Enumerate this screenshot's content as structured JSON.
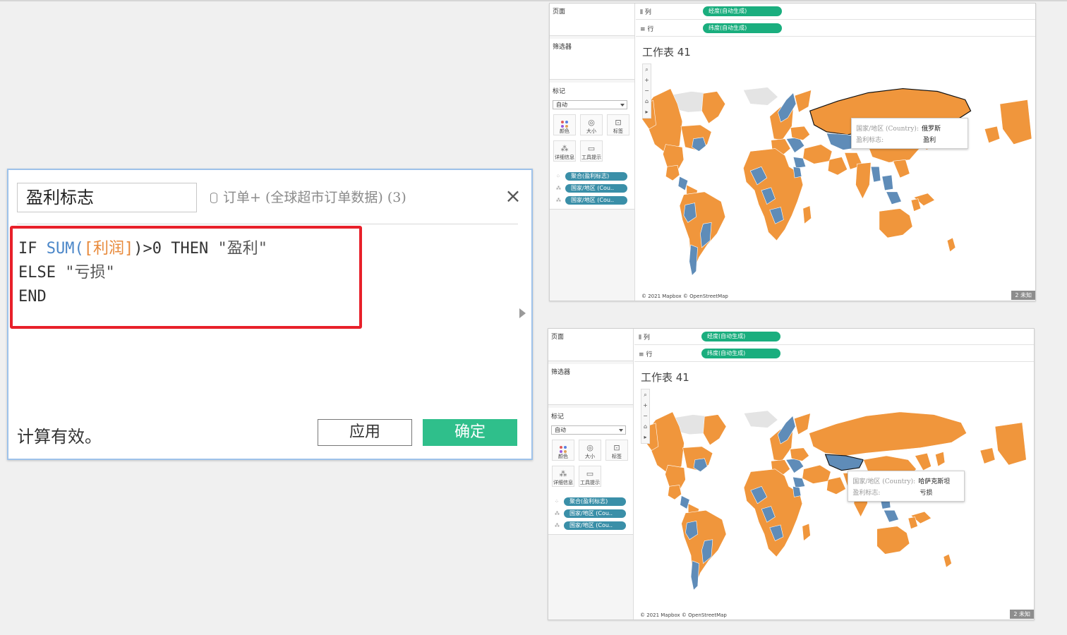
{
  "dialog": {
    "calc_name": "盈利标志",
    "data_source": "订单+ (全球超市订单数据) (3)",
    "close_glyph": "×",
    "code": {
      "l1_if": "IF ",
      "l1_fn": "SUM(",
      "l1_field": "[利润]",
      "l1_rest": ")>0 THEN ",
      "l1_str": "\"盈利\"",
      "l2_else": "ELSE ",
      "l2_str": "\"亏损\"",
      "l3_end": "END"
    },
    "status": "计算有效。",
    "apply_label": "应用",
    "ok_label": "确定",
    "highlight_color": "#e8202a"
  },
  "windows": [
    {
      "pages_label": "页面",
      "filters_label": "筛选器",
      "marks_label": "标记",
      "marks_type": "自动",
      "mark_buttons": [
        "颜色",
        "大小",
        "标签",
        "详细信息",
        "工具提示"
      ],
      "pills": [
        "聚合(盈利标志)",
        "国家/地区 (Cou..",
        "国家/地区 (Cou.."
      ],
      "col_shelf_label": "列",
      "row_shelf_label": "行",
      "col_pill": "经度(自动生成)",
      "row_pill": "纬度(自动生成)",
      "title": "工作表 41",
      "attribution": "© 2021 Mapbox © OpenStreetMap",
      "unknown_badge": "2 未知",
      "tooltip": {
        "country_label": "国家/地区 (Country):",
        "country_value": "俄罗斯",
        "flag_label": "盈利标志:",
        "flag_value": "盈利"
      }
    },
    {
      "pages_label": "页面",
      "filters_label": "筛选器",
      "marks_label": "标记",
      "marks_type": "自动",
      "mark_buttons": [
        "颜色",
        "大小",
        "标签",
        "详细信息",
        "工具提示"
      ],
      "pills": [
        "聚合(盈利标志)",
        "国家/地区 (Cou..",
        "国家/地区 (Cou.."
      ],
      "col_shelf_label": "列",
      "row_shelf_label": "行",
      "col_pill": "经度(自动生成)",
      "row_pill": "纬度(自动生成)",
      "title": "工作表 41",
      "attribution": "© 2021 Mapbox © OpenStreetMap",
      "unknown_badge": "2 未知",
      "tooltip": {
        "country_label": "国家/地区 (Country):",
        "country_value": "哈萨克斯坦",
        "flag_label": "盈利标志:",
        "flag_value": "亏损"
      }
    }
  ],
  "colors": {
    "profit": "#f0963c",
    "loss": "#5f8cb8",
    "no_data": "#e4e4e4",
    "accent_green": "#1aae7e",
    "pill_blue": "#3a8fa8"
  },
  "icons": [
    "database-icon",
    "close-icon",
    "zoom-icon",
    "color-icon",
    "size-icon",
    "label-icon",
    "detail-icon",
    "tooltip-icon",
    "dropdown-arrow-icon"
  ]
}
